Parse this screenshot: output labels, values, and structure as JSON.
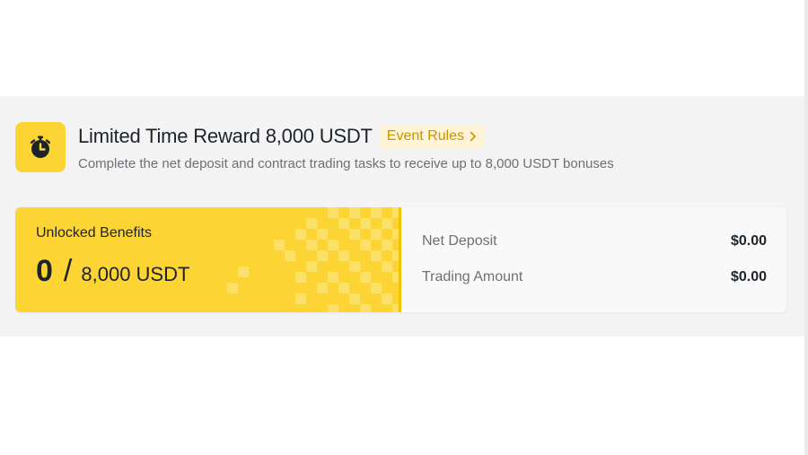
{
  "promo": {
    "title": "Limited Time Reward 8,000 USDT",
    "rules_label": "Event Rules",
    "subtitle": "Complete the net deposit and contract trading tasks to receive up to 8,000 USDT bonuses",
    "icon": "alarm-clock-icon"
  },
  "benefits": {
    "label": "Unlocked Benefits",
    "current": "0",
    "separator": "/",
    "total": "8,000 USDT"
  },
  "stats": [
    {
      "label": "Net Deposit",
      "value": "$0.00"
    },
    {
      "label": "Trading Amount",
      "value": "$0.00"
    }
  ],
  "colors": {
    "brand_yellow": "#fcd535",
    "rules_text": "#c99400",
    "rules_bg": "#fff5d6",
    "panel_bg": "#f4f4f4",
    "text_primary": "#1e2329",
    "text_secondary": "#6d6f74"
  }
}
